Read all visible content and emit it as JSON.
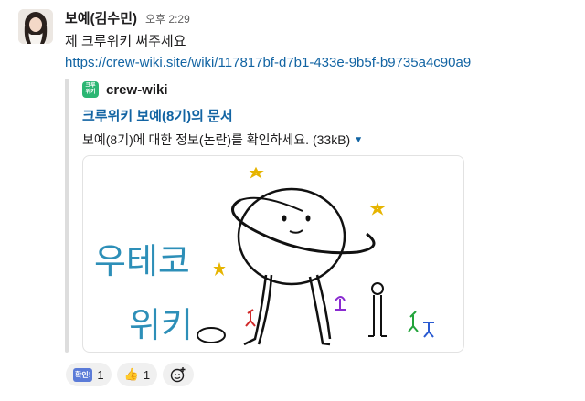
{
  "message": {
    "sender": "보예(김수민)",
    "time": "오후 2:29",
    "text": "제 크루위키 써주세요",
    "link": "https://crew-wiki.site/wiki/117817bf-d7b1-433e-9b5f-b9735a4c90a9"
  },
  "unfurl": {
    "site_icon_text": "크루\n위키",
    "site_name": "crew-wiki",
    "title": "크루위키 보예(8기)의 문서",
    "description": "보예(8기)에 대한 정보(논란)를 확인하세요. (33kB)",
    "preview_handwriting": "우테코\n위키",
    "accent_color": "#1264a3",
    "icon_color": "#2bb673"
  },
  "reactions": [
    {
      "emoji_label": "확인!",
      "count": "1"
    },
    {
      "emoji_label": "👍",
      "count": "1"
    }
  ],
  "icons": {
    "caret": "caret-down-icon",
    "add_reaction": "add-reaction-icon"
  }
}
